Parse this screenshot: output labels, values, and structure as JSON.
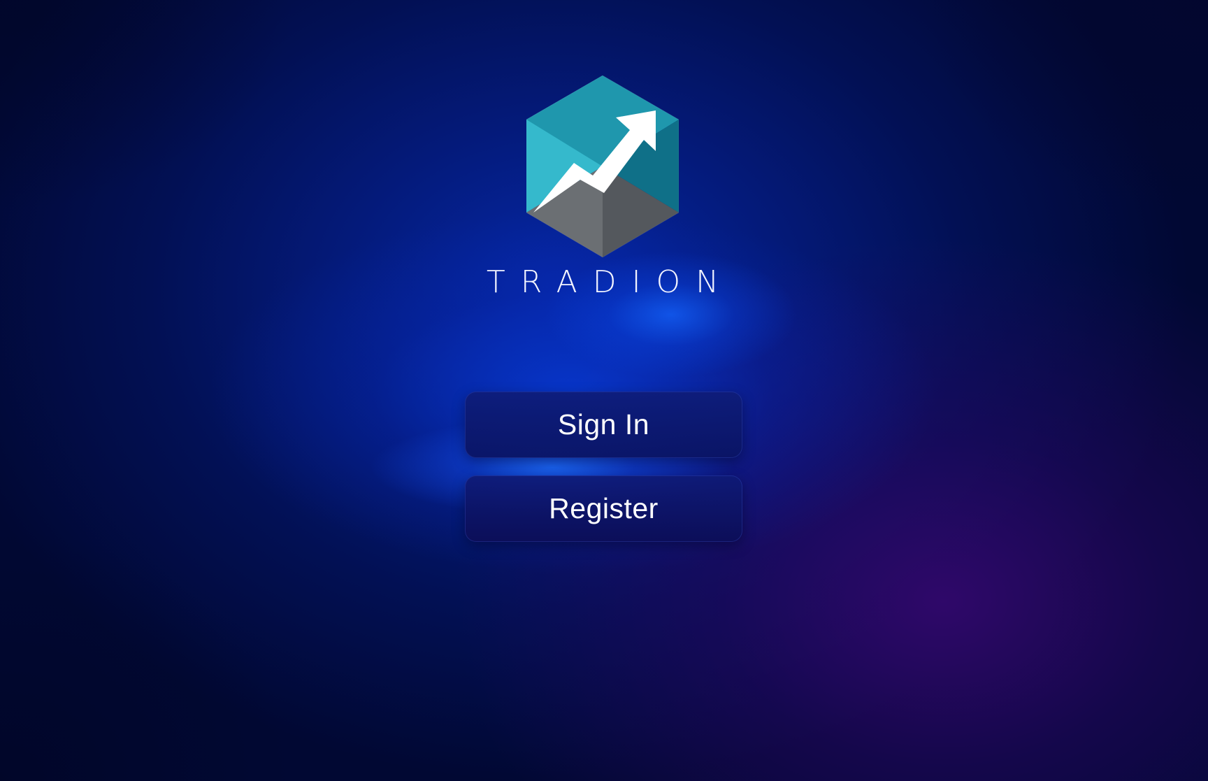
{
  "brand": {
    "name": "TRADION",
    "logo_icon": "hexagon-trend-arrow-icon",
    "colors": {
      "teal_light": "#35b9cc",
      "teal_mid": "#1f97ad",
      "teal_dark": "#0f7088",
      "gray_left": "#6b6f73",
      "gray_right": "#54585d",
      "arrow": "#ffffff"
    }
  },
  "actions": {
    "sign_in_label": "Sign In",
    "register_label": "Register"
  },
  "theme": {
    "background_primary": "#0628a8",
    "background_dark": "#010833",
    "accent_glow": "#1e6eff",
    "accent_purple": "#34086e",
    "button_bg": "#0e1c78",
    "text": "#ffffff"
  }
}
